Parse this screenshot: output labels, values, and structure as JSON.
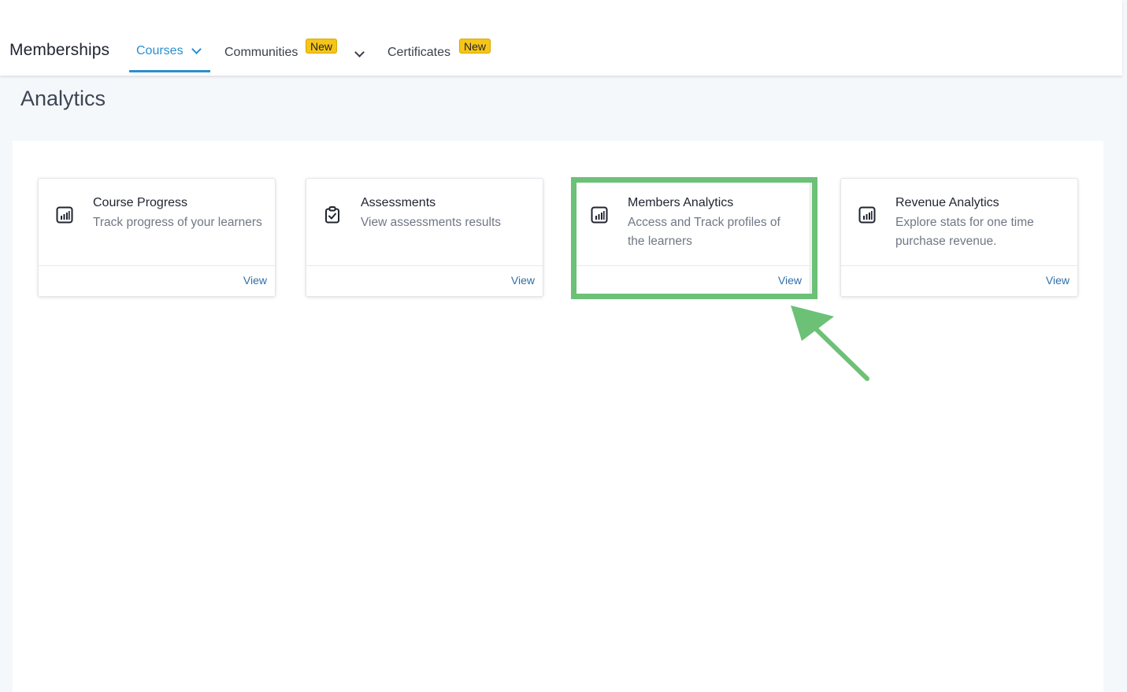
{
  "header": {
    "title": "Memberships",
    "tabs": [
      {
        "label": "Courses",
        "active": true
      },
      {
        "label": "Communities",
        "badge": "New"
      },
      {
        "label": "Certificates",
        "badge": "New"
      }
    ]
  },
  "page": {
    "title": "Analytics"
  },
  "cards": [
    {
      "title": "Course Progress",
      "description": "Track progress of your learners",
      "icon": "bar-chart-icon",
      "action": "View"
    },
    {
      "title": "Assessments",
      "description": "View assessments results",
      "icon": "clipboard-check-icon",
      "action": "View"
    },
    {
      "title": "Members Analytics",
      "description": "Access and Track profiles of the learners",
      "icon": "bar-chart-icon",
      "action": "View",
      "highlighted": true
    },
    {
      "title": "Revenue Analytics",
      "description": "Explore stats for one time purchase revenue.",
      "icon": "bar-chart-icon",
      "action": "View"
    }
  ],
  "colors": {
    "accent": "#2b8fd0",
    "badge": "#f5c518",
    "highlight": "#6cc177",
    "link": "#2f6fa8"
  }
}
